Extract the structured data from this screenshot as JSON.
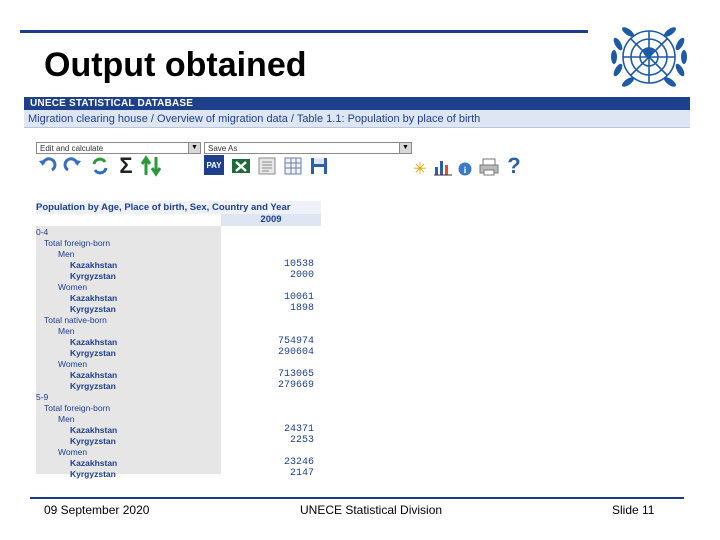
{
  "slide": {
    "title": "Output obtained",
    "date": "09 September 2020",
    "organization": "UNECE Statistical Division",
    "slide_number": "Slide 11"
  },
  "db": {
    "header": "UNECE STATISTICAL DATABASE",
    "breadcrumb": "Migration clearing house / Overview of migration data / Table 1.1: Population by place of birth"
  },
  "toolbar": {
    "layout_select": "Edit and calculate",
    "saveas_select": "Save As",
    "payline_label": "PAY"
  },
  "table": {
    "header": "Population by Age, Place of birth, Sex, Country and Year",
    "year": "2009",
    "rows": [
      {
        "label": "0-4",
        "level": 0,
        "value": ""
      },
      {
        "label": "Total foreign-born",
        "level": 1,
        "value": ""
      },
      {
        "label": "Men",
        "level": 2,
        "value": ""
      },
      {
        "label": "Kazakhstan",
        "level": 3,
        "value": "10538"
      },
      {
        "label": "Kyrgyzstan",
        "level": 3,
        "value": "2000"
      },
      {
        "label": "Women",
        "level": 2,
        "value": ""
      },
      {
        "label": "Kazakhstan",
        "level": 3,
        "value": "10061"
      },
      {
        "label": "Kyrgyzstan",
        "level": 3,
        "value": "1898"
      },
      {
        "label": "Total native-born",
        "level": 1,
        "value": ""
      },
      {
        "label": "Men",
        "level": 2,
        "value": ""
      },
      {
        "label": "Kazakhstan",
        "level": 3,
        "value": "754974"
      },
      {
        "label": "Kyrgyzstan",
        "level": 3,
        "value": "290604"
      },
      {
        "label": "Women",
        "level": 2,
        "value": ""
      },
      {
        "label": "Kazakhstan",
        "level": 3,
        "value": "713065"
      },
      {
        "label": "Kyrgyzstan",
        "level": 3,
        "value": "279669"
      },
      {
        "label": "5-9",
        "level": 0,
        "value": ""
      },
      {
        "label": "Total foreign-born",
        "level": 1,
        "value": ""
      },
      {
        "label": "Men",
        "level": 2,
        "value": ""
      },
      {
        "label": "Kazakhstan",
        "level": 3,
        "value": "24371"
      },
      {
        "label": "Kyrgyzstan",
        "level": 3,
        "value": "2253"
      },
      {
        "label": "Women",
        "level": 2,
        "value": ""
      },
      {
        "label": "Kazakhstan",
        "level": 3,
        "value": "23246"
      },
      {
        "label": "Kyrgyzstan",
        "level": 3,
        "value": "2147"
      }
    ]
  },
  "colors": {
    "accent": "#1e3f8a",
    "rule": "#1f3b8c"
  }
}
